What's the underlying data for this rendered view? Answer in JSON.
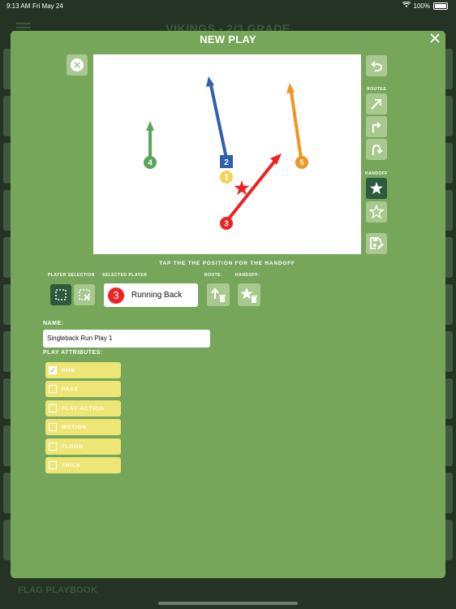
{
  "status_bar": {
    "time": "9:13 AM",
    "date": "Fri May 24",
    "battery": "100%"
  },
  "background": {
    "title": "VIKINGS - 2/3 GRADE",
    "footer": "FLAG PLAYBOOK"
  },
  "modal": {
    "title": "NEW PLAY",
    "hint": "TAP THE THE POSITION FOR THE HANDOFF"
  },
  "side_tools": {
    "routes_label": "ROUTES",
    "handoff_label": "HANDOFF"
  },
  "players": [
    {
      "number": "4",
      "shape": "circle",
      "color": "#5aa55a"
    },
    {
      "number": "2",
      "shape": "square",
      "color": "#2f5fae"
    },
    {
      "number": "1",
      "shape": "circle",
      "color": "#f5d35a"
    },
    {
      "number": "5",
      "shape": "circle",
      "color": "#f0961e"
    },
    {
      "number": "3",
      "shape": "circle",
      "color": "#ee2222"
    }
  ],
  "controls": {
    "player_selection_label": "PLAYER SELECTION",
    "selected_player_label": "SELECTED PLAYER",
    "route_label": "ROUTE:",
    "handoff_label": "HANDOFF:",
    "selected_player": {
      "number": "3",
      "name": "Running Back",
      "color": "#ee2222"
    }
  },
  "form": {
    "name_label": "NAME:",
    "name_value": "Singleback Run Play 1",
    "attributes_label": "PLAY ATTRIBUTES:",
    "attributes": [
      {
        "label": "RUN",
        "checked": true
      },
      {
        "label": "PASS",
        "checked": false
      },
      {
        "label": "PLAY-ACTION",
        "checked": false
      },
      {
        "label": "MOTION",
        "checked": false
      },
      {
        "label": "FLOOD",
        "checked": false
      },
      {
        "label": "TRICK",
        "checked": false
      }
    ]
  },
  "colors": {
    "modal_bg": "#76a65a",
    "button_light": "#a7c88f",
    "button_dark": "#2d5a3c",
    "attribute_bg": "#ede575"
  }
}
